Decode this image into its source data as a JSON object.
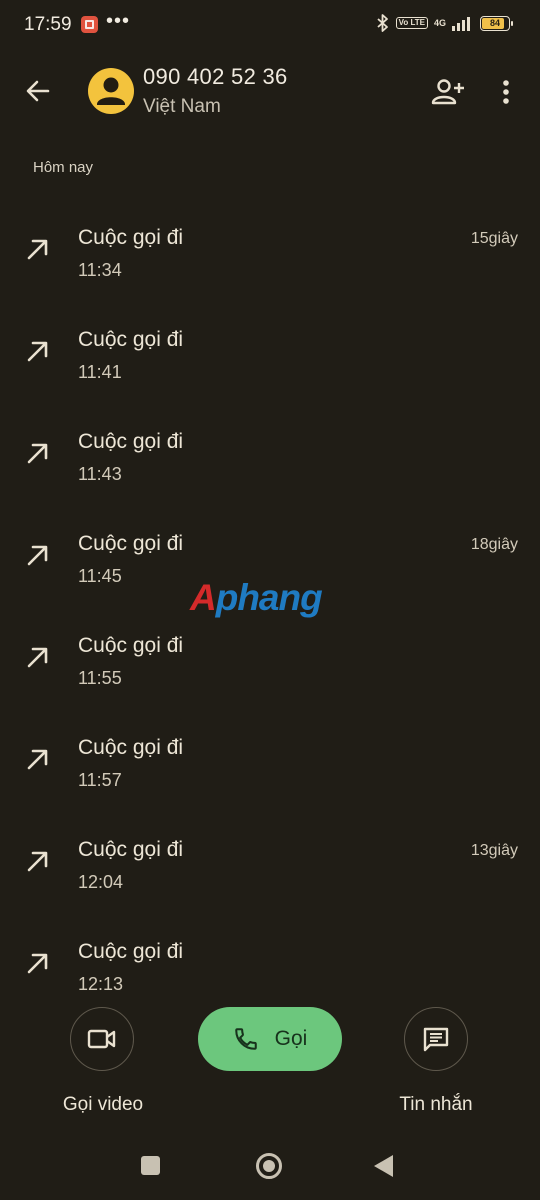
{
  "status_bar": {
    "time": "17:59",
    "more": "•••",
    "volte": "Vo LTE",
    "network": "4G",
    "battery_level": 84,
    "battery_text": "84",
    "battery_color": "#f0c04a"
  },
  "header": {
    "back_icon": "arrow-left-icon",
    "phone_number": "090 402 52 36",
    "country": "Việt Nam",
    "avatar_color": "#f3c33d",
    "add_contact_icon": "person-add-icon",
    "more_icon": "more-vert-icon"
  },
  "section": {
    "label": "Hôm nay"
  },
  "calls": [
    {
      "type": "Cuộc gọi đi",
      "time": "11:34",
      "duration": "15giây"
    },
    {
      "type": "Cuộc gọi đi",
      "time": "11:41",
      "duration": ""
    },
    {
      "type": "Cuộc gọi đi",
      "time": "11:43",
      "duration": ""
    },
    {
      "type": "Cuộc gọi đi",
      "time": "11:45",
      "duration": "18giây"
    },
    {
      "type": "Cuộc gọi đi",
      "time": "11:55",
      "duration": ""
    },
    {
      "type": "Cuộc gọi đi",
      "time": "11:57",
      "duration": ""
    },
    {
      "type": "Cuộc gọi đi",
      "time": "12:04",
      "duration": "13giây"
    },
    {
      "type": "Cuộc gọi đi",
      "time": "12:13",
      "duration": ""
    }
  ],
  "watermark": {
    "first": "A",
    "rest": "phang"
  },
  "actions": {
    "video_label": "Gọi video",
    "call_label": "Gọi",
    "message_label": "Tin nhắn",
    "call_color": "#6cc77d"
  },
  "colors": {
    "background": "#201d16",
    "text": "#e9e1d0"
  }
}
